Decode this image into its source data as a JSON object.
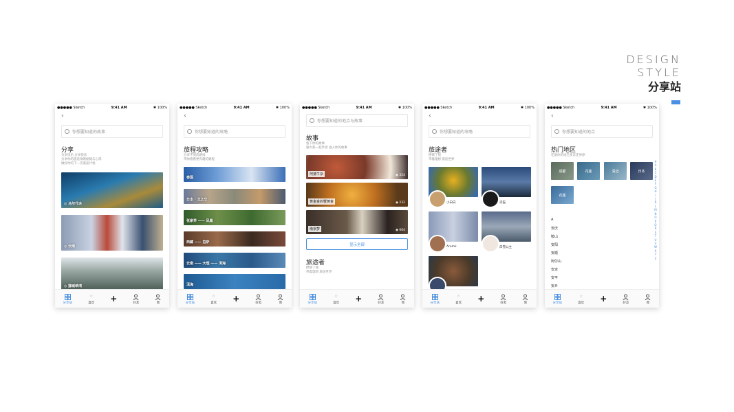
{
  "brand": {
    "line1": "DESIGN",
    "line2": "STYLE",
    "title": "分享站"
  },
  "status": {
    "carrier": "●●●●● Sketch",
    "time": "9:41 AM",
    "battery": "✱ 100%"
  },
  "tabs": [
    "分享站",
    "喜欢",
    "",
    "好友",
    "我"
  ],
  "screen1": {
    "search_placeholder": "你想要知道的故事",
    "title": "分享",
    "desc": [
      "分享快乐 分享快乐",
      "分享你的旅途攻略秘籍与心得",
      "做好你的下一次旅途计划"
    ],
    "cards": [
      {
        "label": "◎ 马尔代夫"
      },
      {
        "label": "◎ 云南"
      },
      {
        "label": "◎ 挪威峡湾"
      }
    ]
  },
  "screen2": {
    "search_placeholder": "你想要知道的攻略",
    "title": "旅程攻略",
    "desc": [
      "分享不到的路线",
      "带你看看更有趣的路程"
    ],
    "routes": [
      "泰国",
      "日本 · 北之华",
      "张家界 —— 凤凰",
      "西藏 —— 拉萨",
      "云南 —— 大理 —— 洱海",
      "洱海"
    ]
  },
  "screen3": {
    "search_placeholder": "你想要知道的地点与故事",
    "title": "故事",
    "desc": [
      "留下你的故事",
      "跟大家一起享受 进入你的故事"
    ],
    "stories": [
      {
        "name": "阿婆牛杂",
        "count": "◉ 324"
      },
      {
        "name": "黄金金的蟹黄金",
        "count": "◉ 232"
      },
      {
        "name": "南京梦",
        "count": "◉ 664"
      }
    ],
    "show_all": "显示全部",
    "travelers_title": "旅途者",
    "travelers_desc": [
      "攒够了钱",
      "带着理想 旅途世界"
    ]
  },
  "screen4": {
    "search_placeholder": "你想要知道的攻略",
    "title": "旅途者",
    "desc": [
      "攒够了钱",
      "带着理想 旅途世界"
    ],
    "users": [
      "小白白",
      "凉猫",
      "Aremk",
      "白雪公主",
      ""
    ]
  },
  "screen5": {
    "search_placeholder": "你想要知道的地点",
    "title": "热门地区",
    "desc": [
      "任意你的地方多去走停停"
    ],
    "regions": [
      "成都",
      "花莲",
      "清迈",
      "日本",
      "花莲"
    ],
    "letter": "A",
    "cities": [
      "安庆",
      "鞍山",
      "安阳",
      "安顺",
      "阿尔山",
      "安定",
      "安平",
      "安乡"
    ],
    "alphabet": [
      "#",
      "A",
      "B",
      "C",
      "D",
      "E",
      "F",
      "G",
      "H",
      "I",
      "J",
      "K",
      "L",
      "M",
      "N",
      "O",
      "P",
      "Q",
      "R",
      "S",
      "T",
      "U",
      "V",
      "W",
      "X",
      "Y",
      "Z"
    ]
  },
  "colors": {
    "accent": "#4a90e2"
  }
}
